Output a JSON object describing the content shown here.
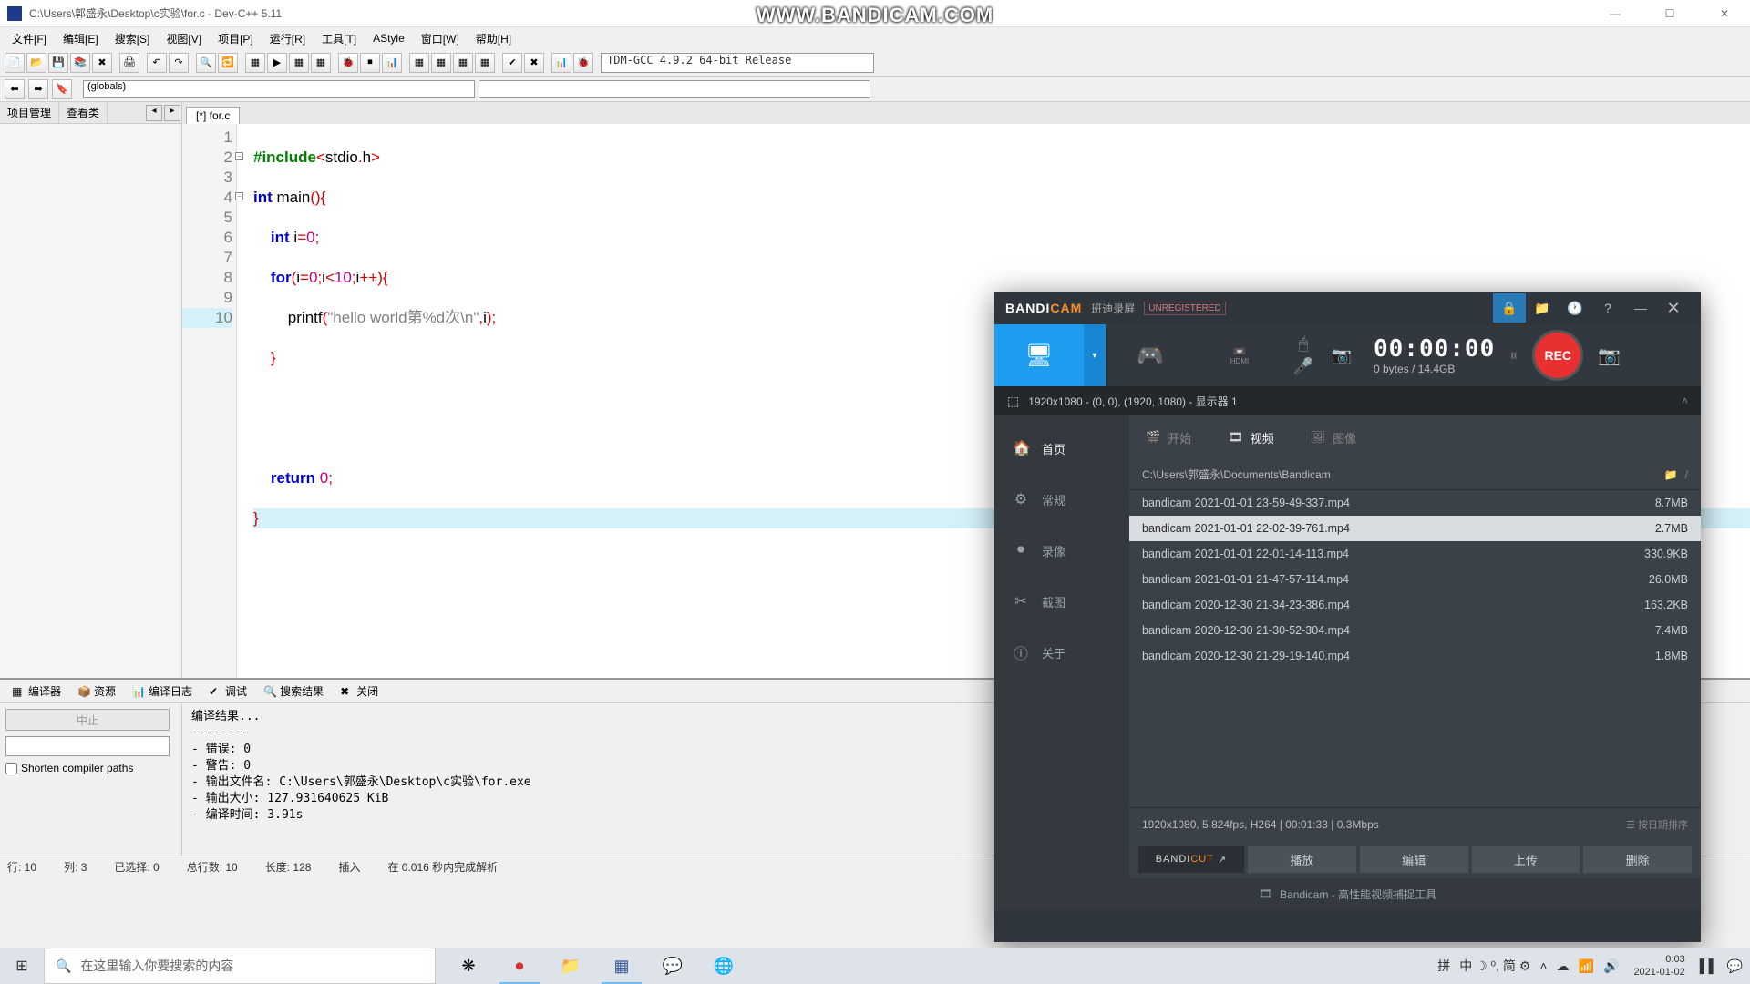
{
  "watermark": "WWW.BANDICAM.COM",
  "devcpp": {
    "title": "C:\\Users\\郭盛永\\Desktop\\c实验\\for.c - Dev-C++ 5.11",
    "menus": [
      "文件[F]",
      "编辑[E]",
      "搜索[S]",
      "视图[V]",
      "项目[P]",
      "运行[R]",
      "工具[T]",
      "AStyle",
      "窗口[W]",
      "帮助[H]"
    ],
    "compiler": "TDM-GCC 4.9.2 64-bit Release",
    "globals": "(globals)",
    "left_tabs": {
      "proj": "项目管理",
      "view": "查看类"
    },
    "editor_tab": "[*] for.c",
    "gutter": [
      "1",
      "2",
      "3",
      "4",
      "5",
      "6",
      "7",
      "8",
      "9",
      "10"
    ],
    "bottom_tabs": {
      "compiler": "编译器",
      "res": "资源",
      "log": "编译日志",
      "debug": "调试",
      "search": "搜索结果",
      "close": "关闭"
    },
    "abort_btn": "中止",
    "shorten_chk": "Shorten compiler paths",
    "compile_output": "编译结果...\n--------\n- 错误: 0\n- 警告: 0\n- 输出文件名: C:\\Users\\郭盛永\\Desktop\\c实验\\for.exe\n- 输出大小: 127.931640625 KiB\n- 编译时间: 3.91s",
    "status": {
      "line": "行:  10",
      "col": "列:   3",
      "sel": "已选择:   0",
      "total": "总行数:   10",
      "len": "长度:  128",
      "mode": "插入",
      "done": "在 0.016 秒内完成解析"
    }
  },
  "bandicam": {
    "sub": "班迪录屏",
    "unreg": "UNREGISTERED",
    "time": "00:00:00",
    "bytes": "0 bytes / 14.4GB",
    "rec": "REC",
    "region": "1920x1080 - (0, 0), (1920, 1080) - 显示器 1",
    "sidebar": [
      {
        "icon": "🏠",
        "label": "首页"
      },
      {
        "icon": "⚙",
        "label": "常规"
      },
      {
        "icon": "⏺",
        "label": "录像"
      },
      {
        "icon": "✂",
        "label": "截图"
      },
      {
        "icon": "ⓘ",
        "label": "关于"
      }
    ],
    "topnav": {
      "start": "开始",
      "video": "视频",
      "image": "图像"
    },
    "path": "C:\\Users\\郭盛永\\Documents\\Bandicam",
    "files": [
      {
        "name": "bandicam 2021-01-01 23-59-49-337.mp4",
        "size": "8.7MB"
      },
      {
        "name": "bandicam 2021-01-01 22-02-39-761.mp4",
        "size": "2.7MB"
      },
      {
        "name": "bandicam 2021-01-01 22-01-14-113.mp4",
        "size": "330.9KB"
      },
      {
        "name": "bandicam 2021-01-01 21-47-57-114.mp4",
        "size": "26.0MB"
      },
      {
        "name": "bandicam 2020-12-30 21-34-23-386.mp4",
        "size": "163.2KB"
      },
      {
        "name": "bandicam 2020-12-30 21-30-52-304.mp4",
        "size": "7.4MB"
      },
      {
        "name": "bandicam 2020-12-30 21-29-19-140.mp4",
        "size": "1.8MB"
      }
    ],
    "info": "1920x1080, 5.824fps, H264 | 00:01:33 | 0.3Mbps",
    "sort": "按日期排序",
    "actions": {
      "play": "播放",
      "edit": "编辑",
      "upload": "上传",
      "delete": "删除"
    },
    "footer": "Bandicam - 高性能视频捕捉工具"
  },
  "taskbar": {
    "search_placeholder": "在这里输入你要搜索的内容",
    "ime": "中 ☽ ⁰, 简 ⚙",
    "clock": {
      "time": "0:03",
      "date": "2021-01-02"
    }
  }
}
